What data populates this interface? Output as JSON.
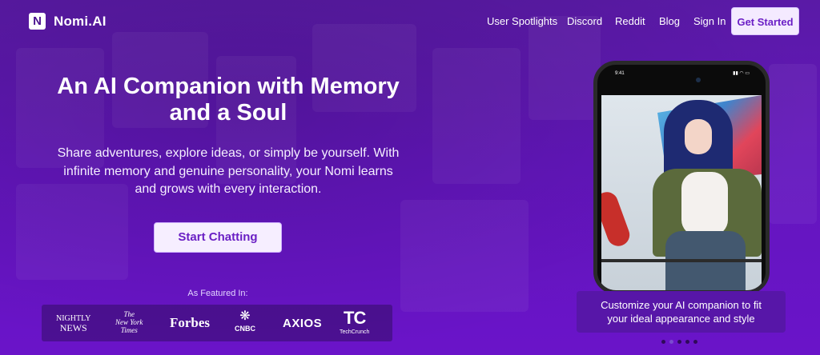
{
  "brand": {
    "logo_letter": "N",
    "name": "Nomi.AI"
  },
  "nav": {
    "links": [
      "User Spotlights",
      "Discord",
      "Reddit",
      "Blog",
      "Sign In"
    ],
    "cta": "Get Started"
  },
  "hero": {
    "title_line1": "An AI Companion with Memory",
    "title_line2": "and a Soul",
    "subtitle_line1": "Share adventures, explore ideas, or simply be yourself. With",
    "subtitle_line2": "infinite memory and genuine personality, your Nomi learns",
    "subtitle_line3": "and grows with every interaction.",
    "cta": "Start Chatting"
  },
  "featured": {
    "label": "As Featured In:",
    "outlets": {
      "nightly_line1": "NIGHTLY",
      "nightly_line2": "NEWS",
      "nyt_line1": "The",
      "nyt_line2": "New York",
      "nyt_line3": "Times",
      "forbes": "Forbes",
      "cnbc": "CNBC",
      "axios": "AXIOS",
      "techcrunch_mark": "TC",
      "techcrunch": "TechCrunch"
    }
  },
  "phone": {
    "time": "9:41",
    "status_icons": "▮▮ ◠ ▭"
  },
  "caption": {
    "line1": "Customize your AI companion to fit",
    "line2": "your ideal appearance and style"
  },
  "carousel": {
    "count": 5,
    "active_index": 1
  },
  "colors": {
    "accent": "#6b1fc6",
    "background": "#6316bd",
    "button_bg": "#f6eeff"
  }
}
